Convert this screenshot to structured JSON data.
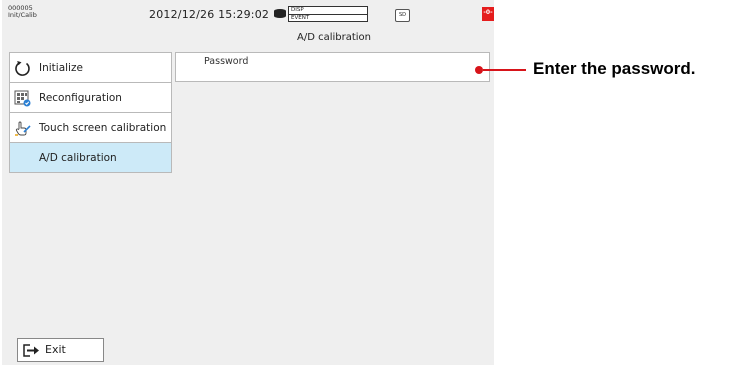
{
  "status_bar": {
    "id_line1": "000005",
    "id_line2": "Init/Calib",
    "datetime": "2012/12/26 15:29:02",
    "disp_label": "DISP",
    "event_label": "EVENT",
    "sd_label": "SD",
    "alarm_glyph": "-0-",
    "alarm_color": "#e51c1c"
  },
  "screen_title": "A/D calibration",
  "menu": {
    "items": [
      {
        "label": "Initialize",
        "icon": "refresh-icon"
      },
      {
        "label": "Reconfiguration",
        "icon": "reconfiguration-icon"
      },
      {
        "label": "Touch screen calibration",
        "icon": "touch-calibration-icon"
      },
      {
        "label": "A/D calibration",
        "icon": "",
        "selected": true
      }
    ],
    "selected_color": "#cdeaf8"
  },
  "password_field": {
    "label": "Password",
    "value": ""
  },
  "exit_button": {
    "label": "Exit",
    "icon": "exit-icon"
  },
  "callout": {
    "text": "Enter the password.",
    "color": "#d7141a"
  }
}
